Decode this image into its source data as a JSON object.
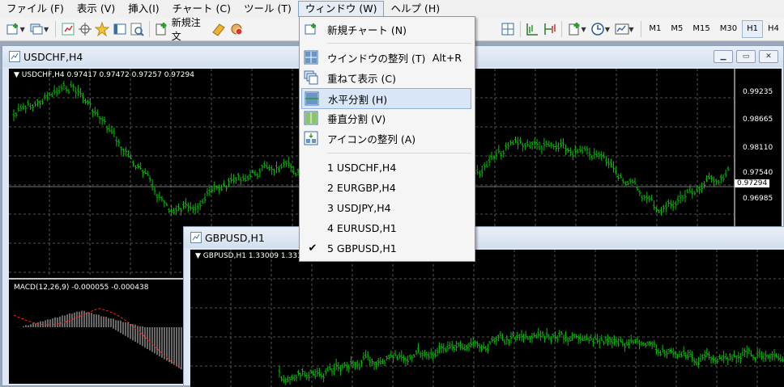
{
  "menubar": {
    "items": [
      "ファイル (F)",
      "表示 (V)",
      "挿入(I)",
      "チャート (C)",
      "ツール (T)",
      "ウィンドウ (W)",
      "ヘルプ (H)"
    ]
  },
  "toolbar": {
    "new_order_label": "新規注文",
    "timeframes": [
      "M1",
      "M5",
      "M15",
      "M30",
      "H1",
      "H4"
    ],
    "active_timeframe": "H1"
  },
  "usdchf_window": {
    "title": "USDCHF,H4",
    "header": "USDCHF,H4  0.97417 0.97472 0.97257 0.97294",
    "price_labels": [
      "0.99235",
      "0.98665",
      "0.98110",
      "0.97540",
      "0.97294",
      "0.96985"
    ],
    "macd_label": "MACD(12,26,9) -0.000055 -0.000438"
  },
  "gbpusd_window": {
    "title": "GBPUSD,H1",
    "header": "GBPUSD,H1  1.33009 1.331"
  },
  "window_menu": {
    "items": [
      {
        "label": "新規チャート (N)",
        "icon": "new-chart-icon"
      },
      {
        "label": "ウインドウの整列 (T)",
        "shortcut": "Alt+R",
        "icon": "tile-windows-icon"
      },
      {
        "label": "重ねて表示 (C)",
        "icon": "cascade-icon"
      },
      {
        "label": "水平分割 (H)",
        "icon": "tile-horizontal-icon"
      },
      {
        "label": "垂直分割 (V)",
        "icon": "tile-vertical-icon"
      },
      {
        "label": "アイコンの整列 (A)",
        "icon": "arrange-icons-icon"
      }
    ],
    "window_list": [
      "1 USDCHF,H4",
      "2 EURGBP,H4",
      "3 USDJPY,H4",
      "4 EURUSD,H1",
      "5 GBPUSD,H1"
    ],
    "selected_item": "水平分割 (H)",
    "checked_window": "5 GBPUSD,H1"
  },
  "colors": {
    "candle": "#00c000",
    "chart_bg": "#000000",
    "grid": "#6a6a6a",
    "macd_signal": "#ff2020"
  }
}
